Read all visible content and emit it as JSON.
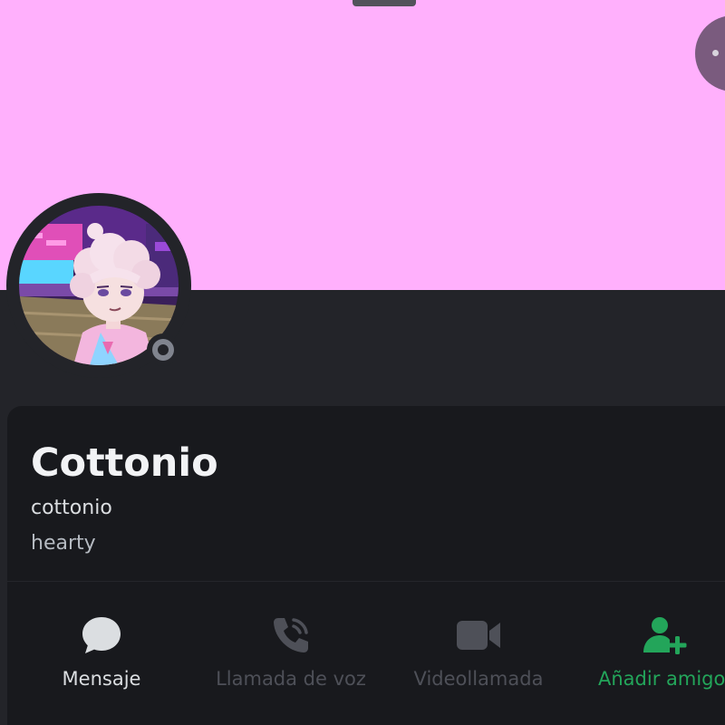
{
  "profile": {
    "display_name": "Cottonio",
    "username": "cottonio",
    "pronouns": "hearty",
    "status": "offline"
  },
  "actions": [
    {
      "label": "Mensaje",
      "icon": "message-bubble-icon",
      "enabled": true
    },
    {
      "label": "Llamada de voz",
      "icon": "phone-icon",
      "enabled": false
    },
    {
      "label": "Videollamada",
      "icon": "video-camera-icon",
      "enabled": false
    },
    {
      "label": "Añadir amigo",
      "icon": "add-friend-icon",
      "enabled": true
    }
  ],
  "colors": {
    "banner": "#ffb0fc",
    "background": "#232429",
    "card": "#18191d",
    "status_offline": "#80848e",
    "add_friend_green": "#23a55a",
    "disabled_text": "#4e5058"
  }
}
